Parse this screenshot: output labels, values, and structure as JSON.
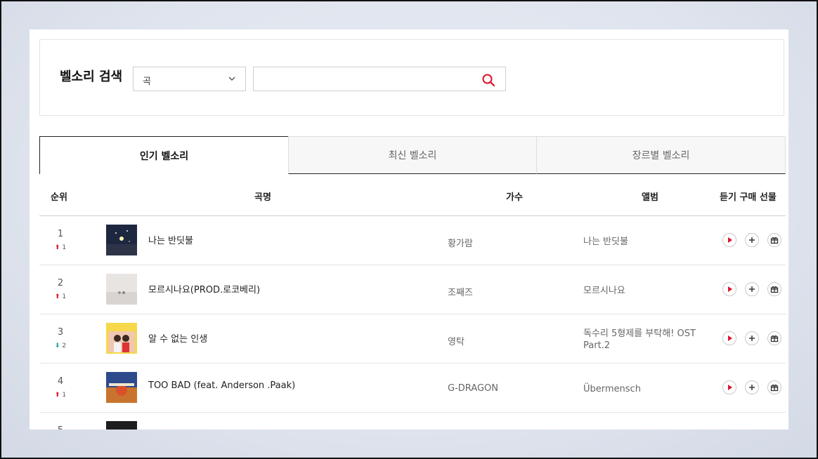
{
  "search": {
    "title": "벨소리 검색",
    "select_value": "곡",
    "input_value": "",
    "input_placeholder": ""
  },
  "tabs": [
    {
      "label": "인기 벨소리",
      "active": true
    },
    {
      "label": "최신 벨소리",
      "active": false
    },
    {
      "label": "장르별 벨소리",
      "active": false
    }
  ],
  "table": {
    "headers": {
      "rank": "순위",
      "song": "곡명",
      "artist": "가수",
      "album": "앨범",
      "actions": "듣기 구매 선물"
    },
    "rows": [
      {
        "rank": "1",
        "delta": "1",
        "direction": "up",
        "song": "나는 반딧불",
        "artist": "황가람",
        "album": "나는 반딧불"
      },
      {
        "rank": "2",
        "delta": "1",
        "direction": "up",
        "song": "모르시나요(PROD.로코베리)",
        "artist": "조째즈",
        "album": "모르시나요"
      },
      {
        "rank": "3",
        "delta": "2",
        "direction": "down",
        "song": "알 수 없는 인생",
        "artist": "영탁",
        "album": "독수리 5형제를 부탁해! OST Part.2"
      },
      {
        "rank": "4",
        "delta": "1",
        "direction": "up",
        "song": "TOO BAD (feat. Anderson .Paak)",
        "artist": "G-DRAGON",
        "album": "Übermensch"
      },
      {
        "rank": "5",
        "delta": "",
        "direction": "",
        "song": "",
        "artist": "",
        "album": ""
      }
    ]
  },
  "icons": {
    "select_chevron": "chevron-down-icon",
    "search": "search-icon",
    "listen": "play-icon",
    "buy": "plus-icon",
    "gift": "gift-icon",
    "up": "arrow-up-icon",
    "down": "arrow-down-icon"
  },
  "colors": {
    "accent_red": "#e0112b",
    "down_teal": "#1aa3a0"
  }
}
